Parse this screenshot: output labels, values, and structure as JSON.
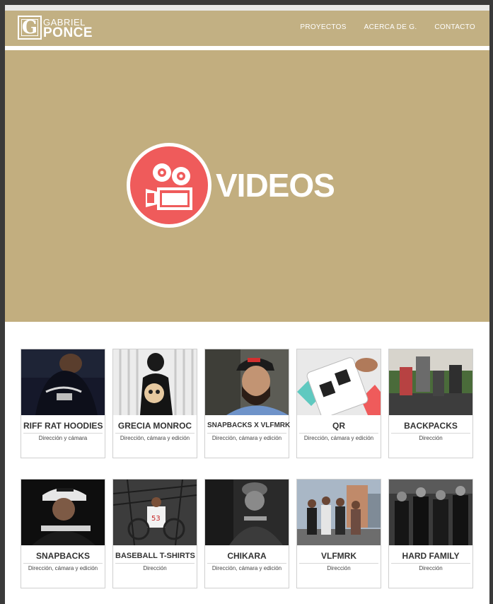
{
  "brand": {
    "logo_letter": "G",
    "line1": "GABRIEL",
    "line2": "PONCE"
  },
  "nav": {
    "items": [
      "PROYECTOS",
      "ACERCA DE G.",
      "CONTACTO"
    ]
  },
  "hero": {
    "title": "VIDEOS",
    "icon": "video-camera-icon"
  },
  "colors": {
    "header_bg": "#c2b083",
    "hero_bg": "#c2ae7f",
    "icon_red": "#ef5b5b"
  },
  "projects": [
    {
      "title": "RIFF RAT HOODIES",
      "role": "Dirección y cámara"
    },
    {
      "title": "GRECIA MONROC",
      "role": "Dirección, cámara y edición"
    },
    {
      "title": "SNAPBACKS X VLFMRK",
      "role": "Dirección, cámara y edición"
    },
    {
      "title": "QR",
      "role": "Dirección, cámara y edición"
    },
    {
      "title": "BACKPACKS",
      "role": "Dirección"
    },
    {
      "title": "SNAPBACKS",
      "role": "Dirección, cámara y edición"
    },
    {
      "title": "BASEBALL T-SHIRTS",
      "role": "Dirección"
    },
    {
      "title": "CHIKARA",
      "role": "Dirección, cámara y edición"
    },
    {
      "title": "VLFMRK",
      "role": "Dirección"
    },
    {
      "title": "HARD FAMILY",
      "role": "Dirección"
    }
  ]
}
